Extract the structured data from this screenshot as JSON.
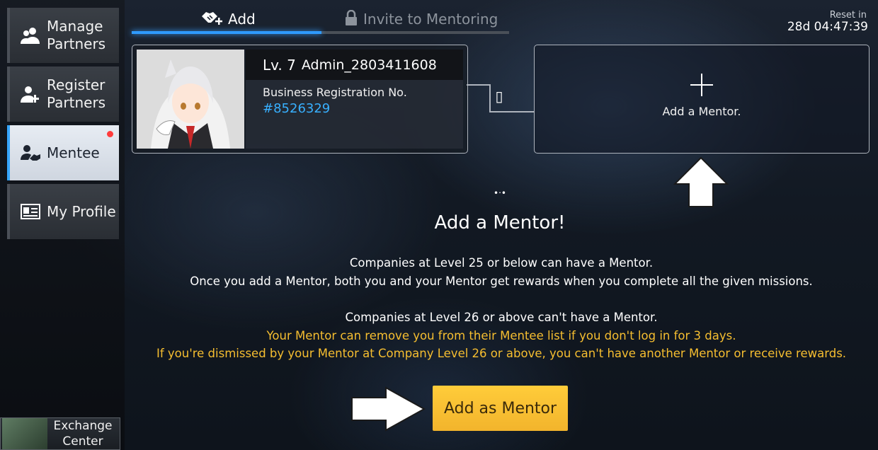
{
  "sidebar": {
    "items": [
      {
        "label": "Manage Partners",
        "icon": "partners-icon"
      },
      {
        "label": "Register Partners",
        "icon": "add-user-icon"
      },
      {
        "label": "Mentee",
        "icon": "handshake-person-icon",
        "active": true,
        "notification": true
      },
      {
        "label": "My Profile",
        "icon": "profile-card-icon"
      }
    ],
    "exchange_label": "Exchange Center"
  },
  "tabs": {
    "add_label": "Add",
    "invite_label": "Invite to Mentoring"
  },
  "reset": {
    "label": "Reset in",
    "time": "28d 04:47:39"
  },
  "profile": {
    "level": "Lv. 7",
    "name": "Admin_2803411608",
    "reg_label": "Business Registration No.",
    "reg_no": "#8526329"
  },
  "connector_glyph": "▯",
  "slot": {
    "label": "Add a Mentor."
  },
  "main": {
    "heading": "Add a Mentor!",
    "line1": "Companies at Level 25 or below can have a Mentor.",
    "line2": "Once you add a Mentor, both you and your Mentor get rewards when you complete all the given missions.",
    "line3": "Companies at Level 26 or above can't have a Mentor.",
    "line4": "Your Mentor can remove you from their Mentee list if you don't log in for 3 days.",
    "line5": "If you're dismissed by your Mentor at Company Level 26 or above, you can't have another Mentor or receive rewards."
  },
  "cta": {
    "label": "Add as Mentor"
  },
  "colors": {
    "accent_blue": "#2f9bff",
    "reg_no": "#38b0ff",
    "warning": "#f6be30",
    "cta": "#f8c232"
  }
}
